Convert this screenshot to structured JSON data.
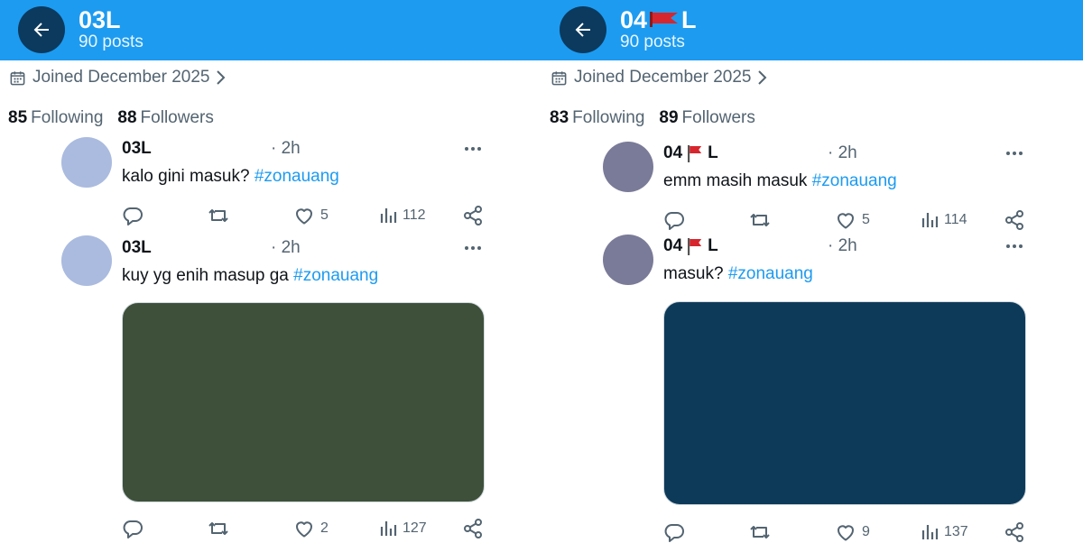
{
  "panels": [
    {
      "header": {
        "name_prefix": "03L",
        "name_suffix": "",
        "has_flag": false,
        "posts": "90 posts",
        "bg": "#1d9bf0"
      },
      "profile": {
        "joined": "Joined December 2025",
        "following_count": "85",
        "following_label": "Following",
        "followers_count": "88",
        "followers_label": "Followers"
      },
      "tweets": [
        {
          "name_prefix": "03L",
          "name_suffix": "",
          "has_flag": false,
          "time": "· 2h",
          "text": "kalo gini masuk?",
          "hashtag": "#zonauang",
          "avatar_color": "#aabbdf",
          "reply": "",
          "retweet": "",
          "likes": "5",
          "views": "112"
        },
        {
          "name_prefix": "03L",
          "name_suffix": "",
          "has_flag": false,
          "time": "· 2h",
          "text": "kuy yg enih masup ga",
          "hashtag": "#zonauang",
          "avatar_color": "#aabbdf",
          "media_color": "#3e503a",
          "reply": "",
          "retweet": "",
          "likes": "2",
          "views": "127"
        }
      ]
    },
    {
      "header": {
        "name_prefix": "04",
        "name_suffix": "L",
        "has_flag": true,
        "posts": "90 posts",
        "bg": "#1d9bf0"
      },
      "profile": {
        "joined": "Joined December 2025",
        "following_count": "83",
        "following_label": "Following",
        "followers_count": "89",
        "followers_label": "Followers"
      },
      "tweets": [
        {
          "name_prefix": "04",
          "name_suffix": "L",
          "has_flag": true,
          "time": "· 2h",
          "text": "emm masih masuk",
          "hashtag": "#zonauang",
          "avatar_color": "#7a7b98",
          "reply": "",
          "retweet": "",
          "likes": "5",
          "views": "114"
        },
        {
          "name_prefix": "04",
          "name_suffix": "L",
          "has_flag": true,
          "time": "· 2h",
          "text": "masuk?",
          "hashtag": "#zonauang",
          "avatar_color": "#7a7b98",
          "media_color": "#0e3a5a",
          "reply": "",
          "retweet": "",
          "likes": "9",
          "views": "137"
        }
      ]
    }
  ],
  "colors": {
    "accent": "#1d9bf0",
    "back_button": "#0b3a5e",
    "secondary_text": "#536471",
    "flag_red": "#d7262e"
  },
  "icons": {
    "back": "arrow-left-icon",
    "calendar": "calendar-icon",
    "chevron": "chevron-right-icon",
    "more": "more-icon",
    "reply": "reply-icon",
    "retweet": "retweet-icon",
    "like": "heart-icon",
    "views": "views-icon",
    "share": "share-icon",
    "flag": "red-flag-emoji"
  }
}
